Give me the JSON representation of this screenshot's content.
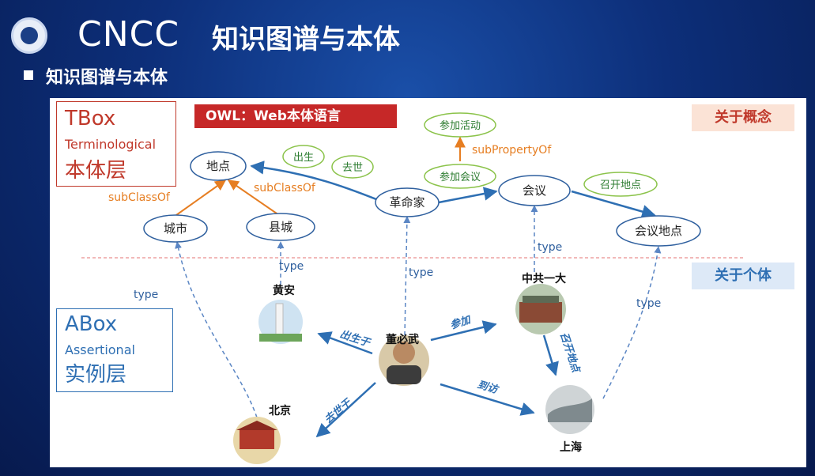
{
  "header": {
    "brand": "CNCC",
    "title": "知识图谱与本体",
    "subtitle": "知识图谱与本体"
  },
  "tbox": {
    "line1": "TBox",
    "line2": "Terminological",
    "line3": "本体层"
  },
  "abox": {
    "line1": "ABox",
    "line2": "Assertional",
    "line3": "实例层"
  },
  "owl_banner": "OWL：Web本体语言",
  "tags": {
    "concept": "关于概念",
    "individual": "关于个体"
  },
  "concepts": {
    "place": "地点",
    "city": "城市",
    "county": "县城",
    "revolutionary": "革命家",
    "meeting": "会议",
    "meeting_place": "会议地点"
  },
  "relations": {
    "born": "出生",
    "died": "去世",
    "attend_meeting": "参加会议",
    "attend_activity": "参加活动",
    "held_at": "召开地点"
  },
  "orange_labels": {
    "subclass_left": "subClassOf",
    "subclass_right": "subClassOf",
    "subproperty": "subPropertyOf"
  },
  "type_label": "type",
  "instances": {
    "huangan": "黄安",
    "dongbiwu": "董必武",
    "beijing": "北京",
    "shanghai": "上海",
    "zhonggong": "中共一大"
  },
  "edge_labels": {
    "born_in": "出生于",
    "attend": "参加",
    "died_in": "去世于",
    "visited": "到访",
    "held_at": "召开地点"
  },
  "colors": {
    "accent_red": "#c62828",
    "accent_blue": "#2e6fb3",
    "orange": "#e67e22",
    "green": "#2e7d32"
  }
}
